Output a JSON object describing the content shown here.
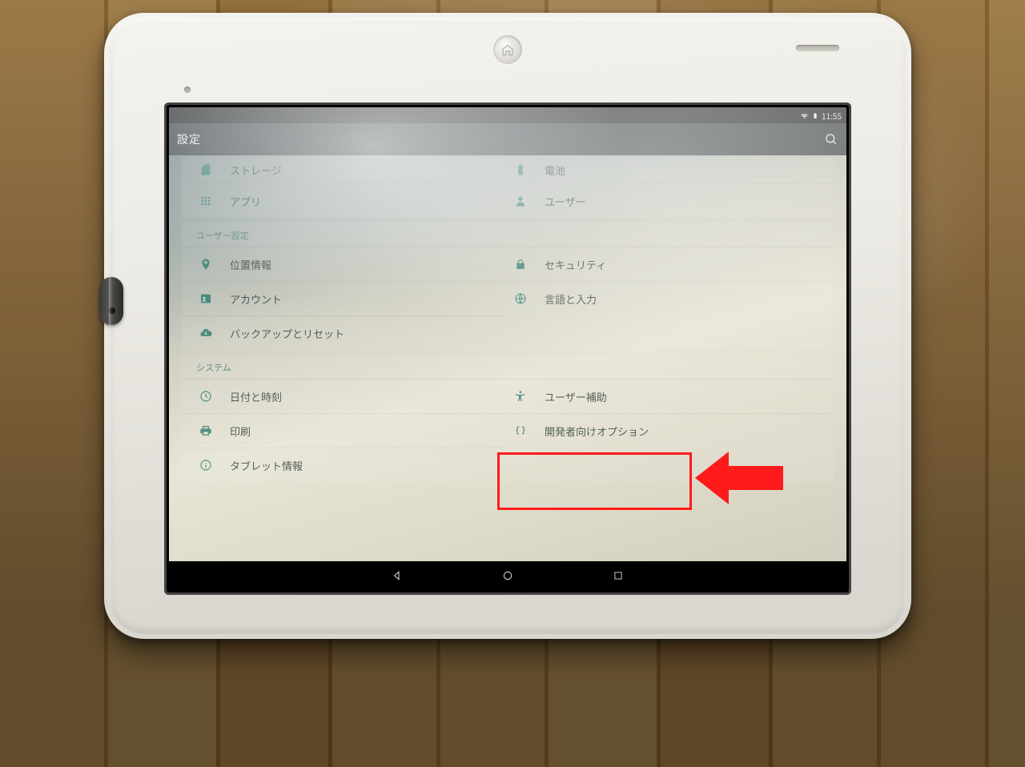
{
  "status": {
    "time": "11:55"
  },
  "appbar": {
    "title": "設定"
  },
  "device": {
    "heading_cut": "",
    "rows": [
      {
        "left": {
          "icon": "sd-card-icon",
          "label": "ストレージ"
        },
        "right": {
          "icon": "battery-icon",
          "label": "電池"
        }
      },
      {
        "left": {
          "icon": "apps-icon",
          "label": "アプリ"
        },
        "right": {
          "icon": "user-icon",
          "label": "ユーザー"
        }
      }
    ]
  },
  "user_settings": {
    "heading": "ユーザー設定",
    "rows": [
      {
        "left": {
          "icon": "location-icon",
          "label": "位置情報"
        },
        "right": {
          "icon": "lock-icon",
          "label": "セキュリティ"
        }
      },
      {
        "left": {
          "icon": "account-icon",
          "label": "アカウント"
        },
        "right": {
          "icon": "globe-icon",
          "label": "言語と入力"
        }
      },
      {
        "left": {
          "icon": "backup-icon",
          "label": "バックアップとリセット"
        },
        "right": null
      }
    ]
  },
  "system": {
    "heading": "システム",
    "rows": [
      {
        "left": {
          "icon": "clock-icon",
          "label": "日付と時刻"
        },
        "right": {
          "icon": "accessibility-icon",
          "label": "ユーザー補助"
        }
      },
      {
        "left": {
          "icon": "print-icon",
          "label": "印刷"
        },
        "right": {
          "icon": "braces-icon",
          "label": "開発者向けオプション"
        }
      },
      {
        "left": {
          "icon": "info-icon",
          "label": "タブレット情報"
        },
        "right": null
      }
    ]
  },
  "annotation": {
    "target": "開発者向けオプション"
  }
}
